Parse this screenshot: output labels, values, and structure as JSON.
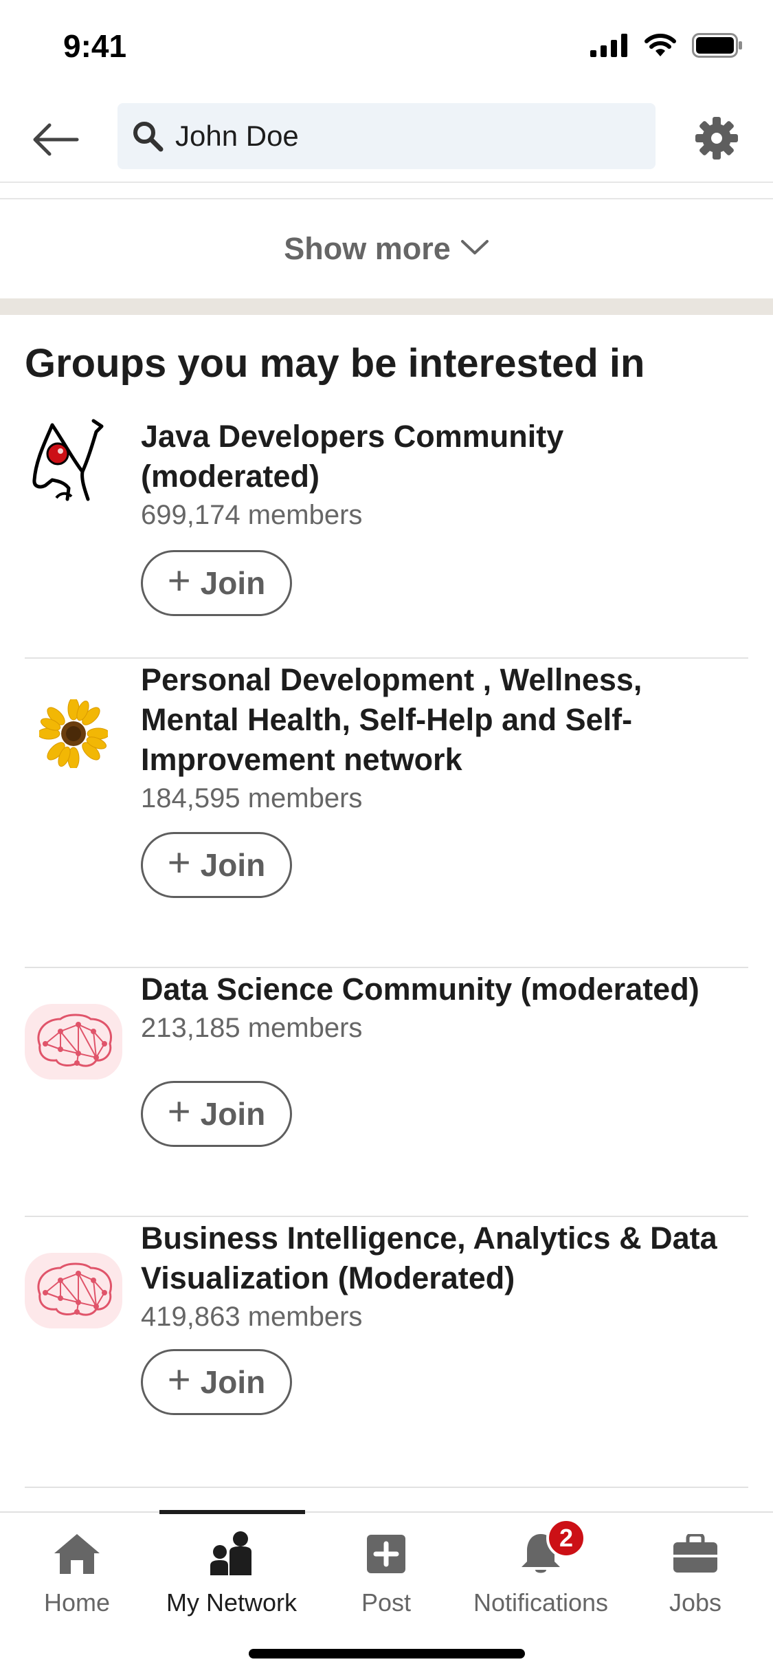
{
  "status_bar": {
    "time": "9:41"
  },
  "search": {
    "value": "John Doe"
  },
  "show_more": {
    "label": "Show more"
  },
  "section": {
    "title": "Groups you may be interested in"
  },
  "groups": [
    {
      "name_line1": "Java Developers Community",
      "name_line2": "(moderated)",
      "name_line3": "",
      "members": "699,174 members",
      "join_label": "Join",
      "logo": "java-duke-icon"
    },
    {
      "name_line1": "Personal Development , Wellness,",
      "name_line2": "Mental Health, Self-Help and Self-",
      "name_line3": "Improvement network",
      "members": "184,595 members",
      "join_label": "Join",
      "logo": "sunflower-icon"
    },
    {
      "name_line1": "Data Science Community (moderated)",
      "name_line2": "",
      "name_line3": "",
      "members": "213,185 members",
      "join_label": "Join",
      "logo": "brain-network-icon"
    },
    {
      "name_line1": "Business Intelligence, Analytics & Data",
      "name_line2": "Visualization (Moderated)",
      "name_line3": "",
      "members": "419,863 members",
      "join_label": "Join",
      "logo": "brain-network-icon"
    }
  ],
  "bottom_nav": {
    "items": [
      {
        "label": "Home",
        "icon": "home-icon"
      },
      {
        "label": "My Network",
        "icon": "network-icon",
        "active": true
      },
      {
        "label": "Post",
        "icon": "post-icon"
      },
      {
        "label": "Notifications",
        "icon": "bell-icon",
        "badge": "2"
      },
      {
        "label": "Jobs",
        "icon": "briefcase-icon"
      }
    ]
  },
  "colors": {
    "accent_badge": "#cc1016",
    "text_primary": "#1d1d1d",
    "text_secondary": "#666666",
    "search_bg": "#eef3f8"
  }
}
